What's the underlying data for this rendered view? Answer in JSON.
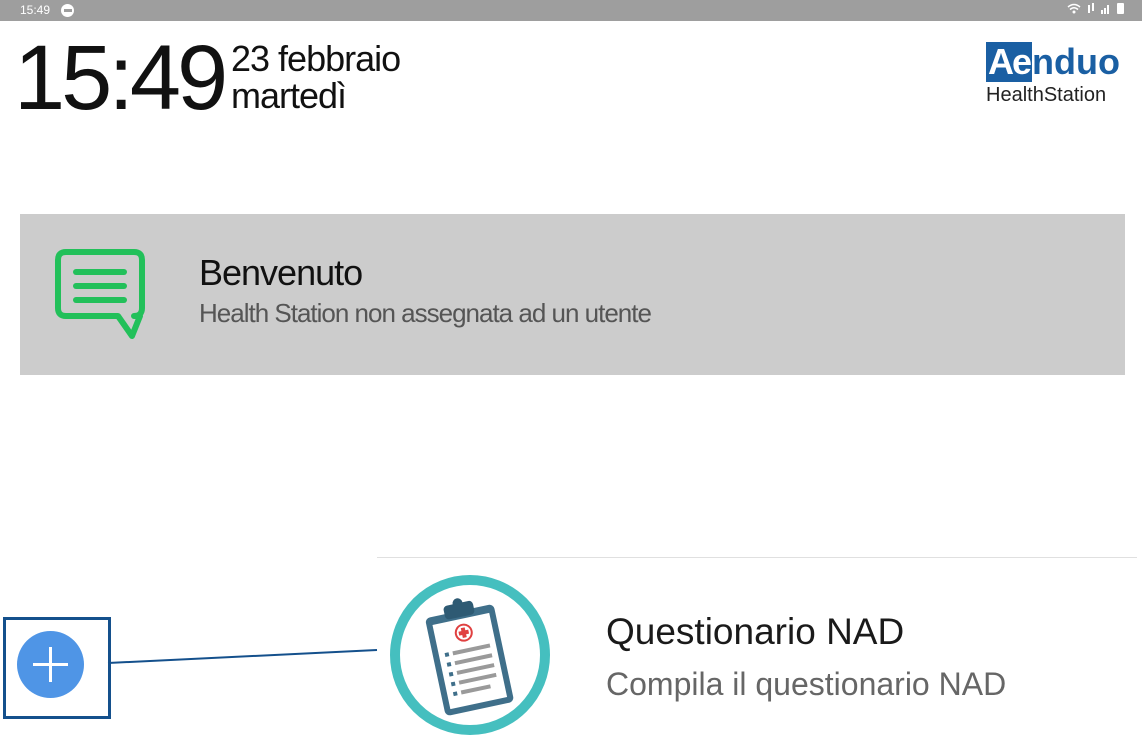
{
  "status_bar": {
    "time": "15:49"
  },
  "header": {
    "clock": "15:49",
    "date_line": "23 febbraio",
    "weekday": "martedì"
  },
  "logo": {
    "brand_highlight": "Ae",
    "brand_rest": "nduo",
    "sub_bold": "Health",
    "sub_rest": "Station"
  },
  "welcome": {
    "title": "Benvenuto",
    "subtitle": "Health Station non assegnata ad un utente",
    "icon": "chat-bubble-icon",
    "icon_color": "#22c05a"
  },
  "questionnaire": {
    "title": "Questionario NAD",
    "subtitle": "Compila il questionario NAD",
    "icon": "clipboard-icon",
    "ring_color": "#45bfbf"
  },
  "add_button": {
    "icon": "plus-icon",
    "color": "#4f95e6"
  },
  "highlight_color": "#14508c"
}
